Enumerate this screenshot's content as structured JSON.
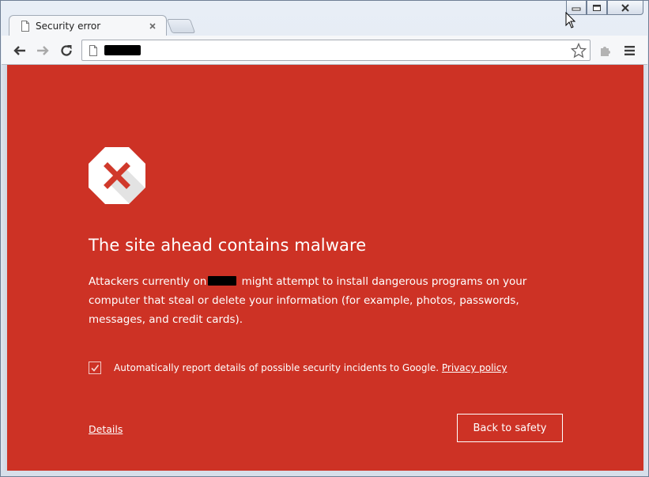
{
  "window": {
    "controls": {
      "minimize_icon": "minimize-icon",
      "maximize_icon": "restore-icon",
      "close_icon": "close-icon"
    }
  },
  "tabs": [
    {
      "title": "Security error",
      "icon": "page-icon",
      "active": true
    }
  ],
  "toolbar": {
    "back_icon": "arrow-left-icon",
    "forward_icon": "arrow-right-icon",
    "reload_icon": "reload-icon",
    "url_redacted": true,
    "bookmark_icon": "star-icon",
    "extension_icon": "puzzle-icon",
    "menu_icon": "hamburger-icon"
  },
  "page": {
    "background_color": "#cd3225",
    "icon": "stop-sign-x-icon",
    "headline": "The site ahead contains malware",
    "body_before": "Attackers currently on",
    "body_after": " might attempt to install dangerous programs on your computer that steal or delete your information (for example, photos, passwords, messages, and credit cards).",
    "report_checkbox": {
      "checked": true,
      "label": "Automatically report details of possible security incidents to Google.",
      "link": "Privacy policy"
    },
    "details_link": "Details",
    "back_button": "Back to safety"
  }
}
